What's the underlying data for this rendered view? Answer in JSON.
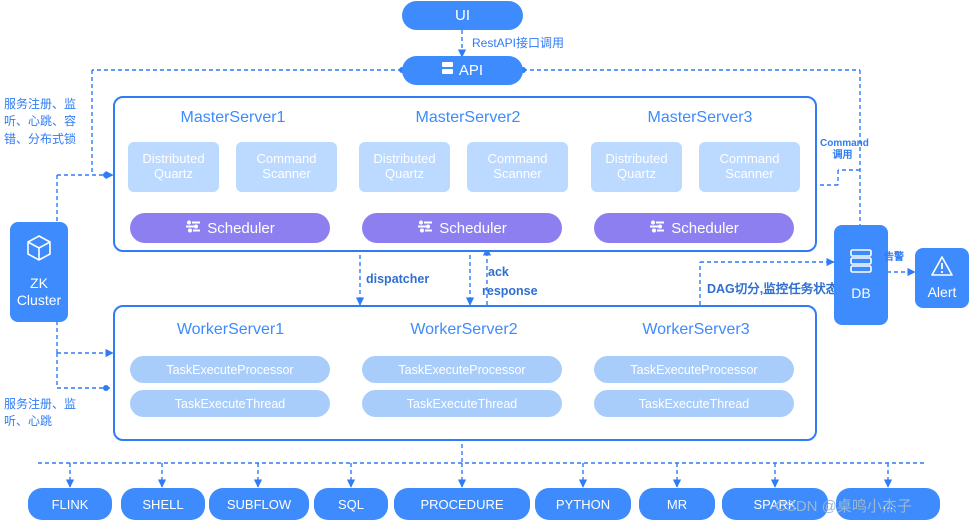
{
  "nodes": {
    "ui": "UI",
    "api": "API",
    "zk": {
      "line1": "ZK",
      "line2": "Cluster"
    },
    "db": "DB",
    "alert": "Alert"
  },
  "masters": [
    {
      "title": "MasterServer1",
      "quartz": "Distributed\nQuartz",
      "scanner": "Command\nScanner",
      "scheduler": "Scheduler"
    },
    {
      "title": "MasterServer2",
      "quartz": "Distributed\nQuartz",
      "scanner": "Command\nScanner",
      "scheduler": "Scheduler"
    },
    {
      "title": "MasterServer3",
      "quartz": "Distributed\nQuartz",
      "scanner": "Command\nScanner",
      "scheduler": "Scheduler"
    }
  ],
  "master_parts": {
    "quartz_l1": "Distributed",
    "quartz_l2": "Quartz",
    "scanner_l1": "Command",
    "scanner_l2": "Scanner",
    "scheduler": "Scheduler"
  },
  "workers": [
    {
      "title": "WorkerServer1",
      "processor": "TaskExecuteProcessor",
      "thread": "TaskExecuteThread"
    },
    {
      "title": "WorkerServer2",
      "processor": "TaskExecuteProcessor",
      "thread": "TaskExecuteThread"
    },
    {
      "title": "WorkerServer3",
      "processor": "TaskExecuteProcessor",
      "thread": "TaskExecuteThread"
    }
  ],
  "tasks": [
    "FLINK",
    "SHELL",
    "SUBFLOW",
    "SQL",
    "PROCEDURE",
    "PYTHON",
    "MR",
    "SPARK",
    "..."
  ],
  "labels": {
    "rest_api": "RestAPI接口调用",
    "zk_register_top": "服务注册、监听、心跳、容错、分布式锁",
    "zk_register_bottom": "服务注册、监听、心跳",
    "dispatcher": "dispatcher",
    "ack": "ack",
    "response": "response",
    "dag": "DAG切分,监控任务状态",
    "command": "Command",
    "command_cn": "调用",
    "alarm": "告警"
  },
  "watermark": "CSDN @桌鸣小杰子",
  "colors": {
    "blue": "#3d8bfd",
    "light_blue": "#bcd9ff",
    "purple": "#8e7ff0",
    "worker_bar": "#a9cdfb",
    "border": "#2f7cf6",
    "text_blue": "#2f7cf6"
  }
}
